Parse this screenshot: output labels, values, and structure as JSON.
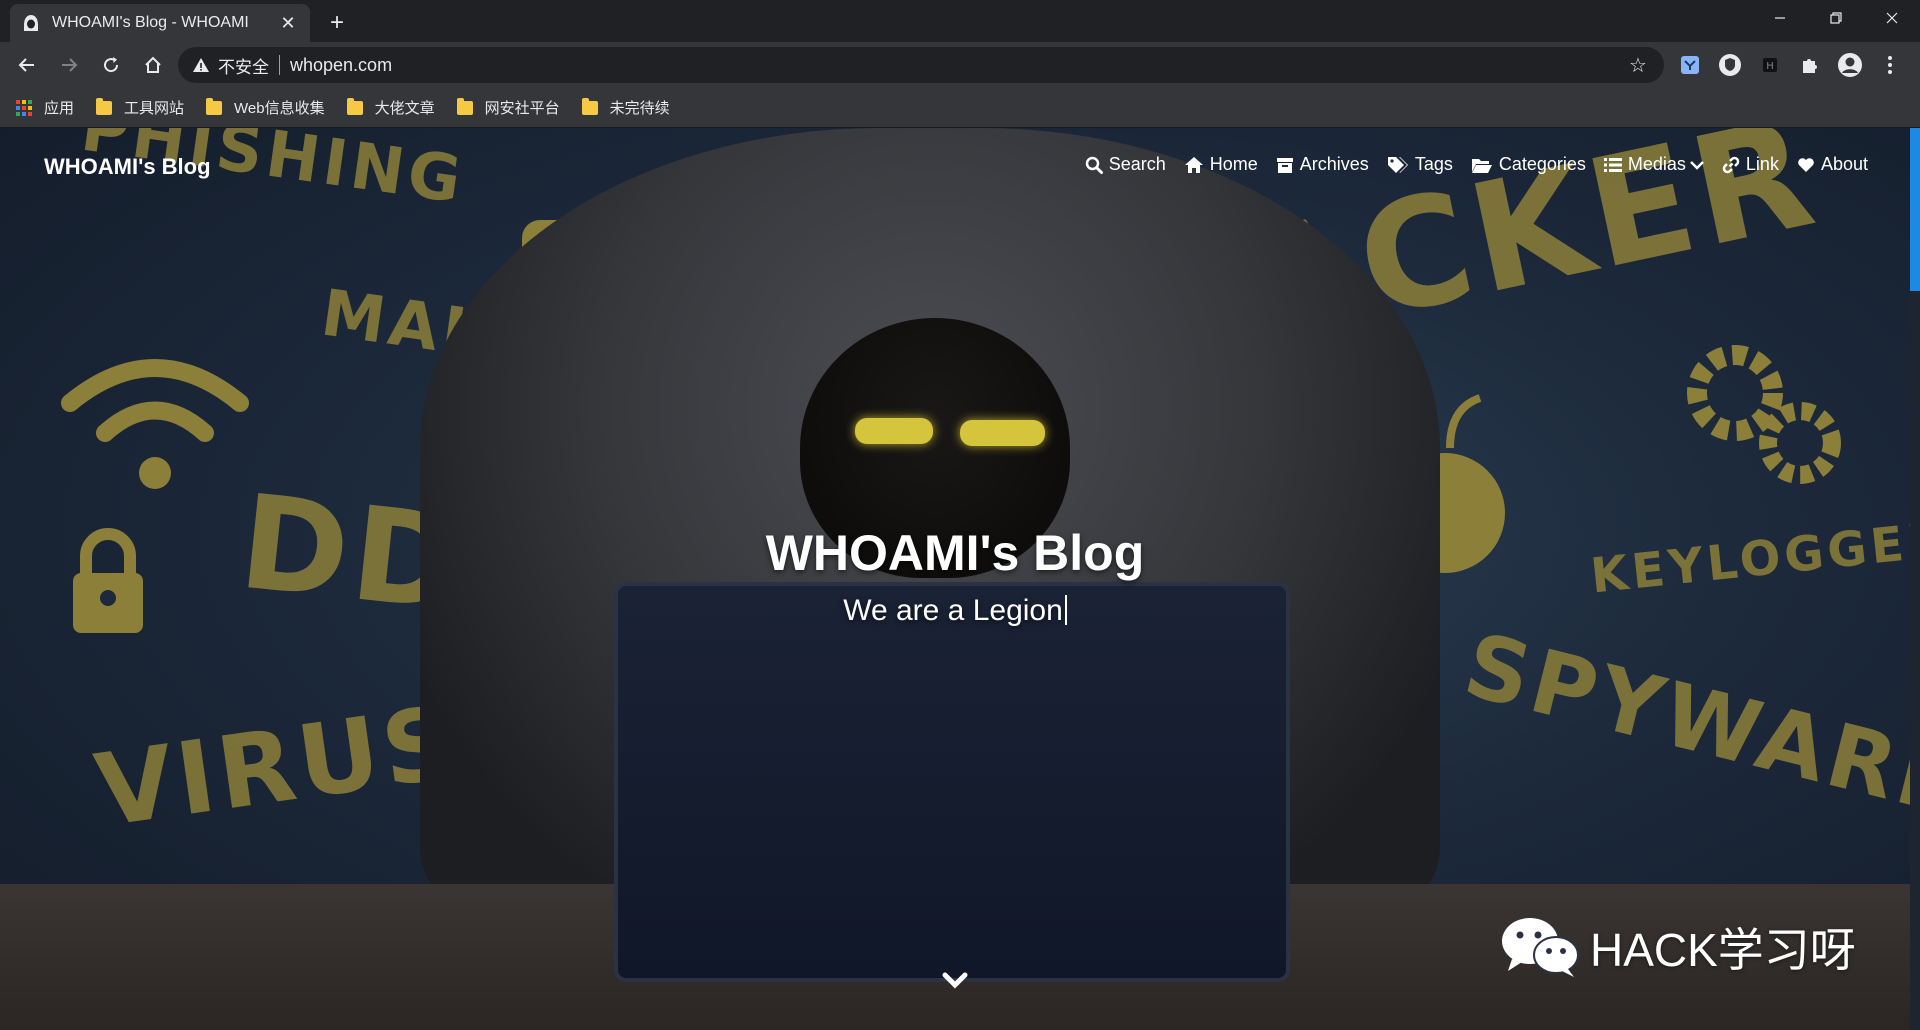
{
  "browser": {
    "tab_title": "WHOAMI's Blog - WHOAMI",
    "tab_close": "✕",
    "new_tab": "+",
    "insecure_label": "不安全",
    "url": "whopen.com",
    "bookmarks": [
      {
        "label": "应用",
        "icon": "apps-grid-icon"
      },
      {
        "label": "工具网站",
        "icon": "folder-icon"
      },
      {
        "label": "Web信息收集",
        "icon": "folder-icon"
      },
      {
        "label": "大佬文章",
        "icon": "folder-icon"
      },
      {
        "label": "网安社平台",
        "icon": "folder-icon"
      },
      {
        "label": "未完待续",
        "icon": "folder-icon"
      }
    ]
  },
  "site": {
    "brand": "WHOAMI's Blog",
    "nav": [
      {
        "label": "Search",
        "icon": "search-icon"
      },
      {
        "label": "Home",
        "icon": "home-icon"
      },
      {
        "label": "Archives",
        "icon": "archive-icon"
      },
      {
        "label": "Tags",
        "icon": "tags-icon"
      },
      {
        "label": "Categories",
        "icon": "folder-open-icon"
      },
      {
        "label": "Medias",
        "icon": "list-icon"
      },
      {
        "label": "Link",
        "icon": "link-icon"
      },
      {
        "label": "About",
        "icon": "heart-icon"
      }
    ],
    "hero_title": "WHOAMI's Blog",
    "hero_subtitle": "We are a Legion",
    "background_words": [
      "PHISHING",
      "MALWARE",
      "DDOS",
      "VIRUS",
      "HACKER",
      "KEYLOGGER",
      "SPYWARE"
    ]
  },
  "watermark": {
    "text": "HACK学习呀",
    "icon": "wechat-icon"
  },
  "colors": {
    "chrome_dark": "#202124",
    "chrome_toolbar": "#35363a",
    "accent_yellow": "#d4c53c",
    "scrollbar_blue": "#1e88e5",
    "folder_yellow": "#f6c945"
  }
}
